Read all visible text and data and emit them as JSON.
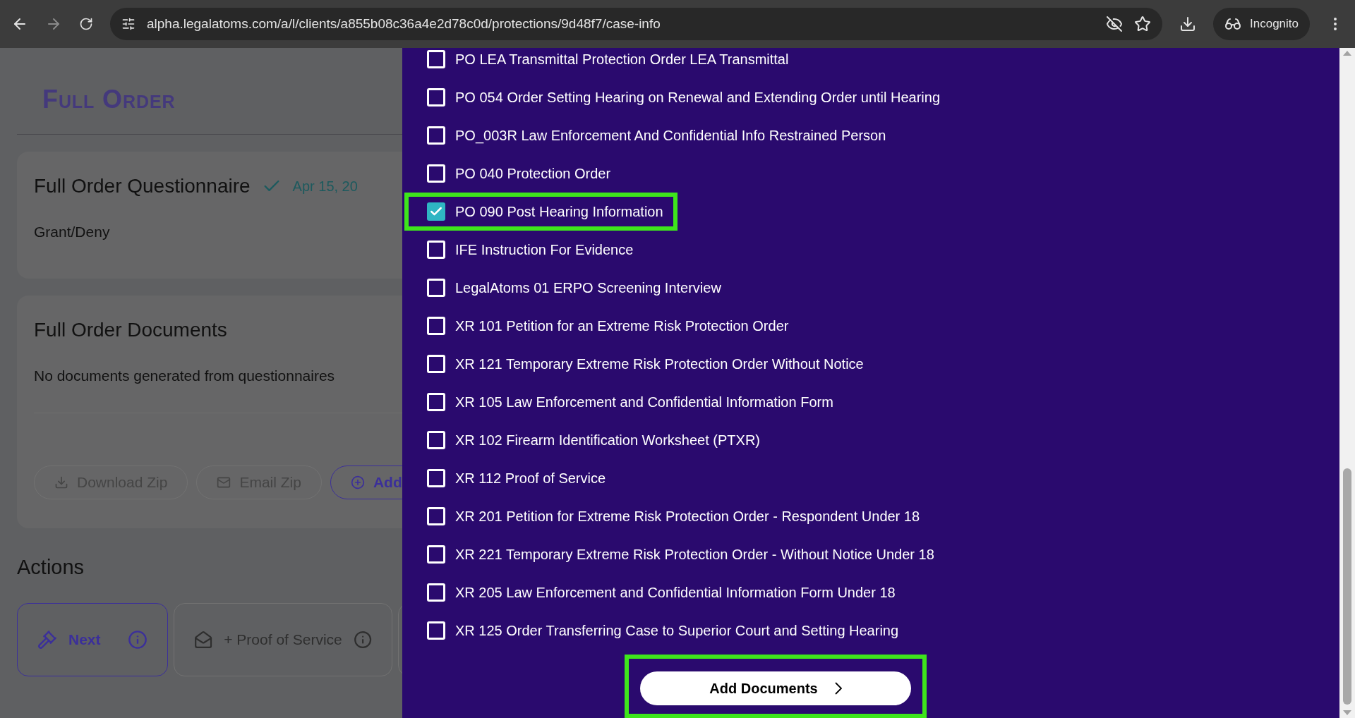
{
  "browser": {
    "url": "alpha.legalatoms.com/a/l/clients/a855b08c36a4e2d78c0d/protections/9d48f7/case-info",
    "profile": "Incognito"
  },
  "page": {
    "title": "Full Order",
    "questionnaire": {
      "title": "Full Order Questionnaire",
      "date": "Apr 15, 20",
      "answer": "Grant/Deny"
    },
    "documents": {
      "title": "Full Order Documents",
      "message": "No documents generated from questionnaires",
      "buttons": [
        {
          "kind": "download",
          "label": "Download Zip"
        },
        {
          "kind": "email",
          "label": "Email Zip"
        },
        {
          "kind": "add",
          "label": "Add"
        }
      ]
    },
    "actions": {
      "title": "Actions",
      "items": [
        {
          "kind": "gavel",
          "label": "Next",
          "selected": true
        },
        {
          "kind": "envelope",
          "label": "+ Proof of Service",
          "selected": false
        },
        {
          "kind": "blank",
          "selected": false
        }
      ]
    }
  },
  "drawer": {
    "documents": [
      {
        "label": "PO LEA Transmittal Protection Order LEA Transmittal",
        "checked": false,
        "highlighted": false
      },
      {
        "label": "PO 054 Order Setting Hearing on Renewal and Extending Order until Hearing",
        "checked": false,
        "highlighted": false
      },
      {
        "label": "PO_003R Law Enforcement And Confidential Info Restrained Person",
        "checked": false,
        "highlighted": false
      },
      {
        "label": "PO 040 Protection Order",
        "checked": false,
        "highlighted": false
      },
      {
        "label": "PO 090 Post Hearing Information",
        "checked": true,
        "highlighted": true
      },
      {
        "label": "IFE Instruction For Evidence",
        "checked": false,
        "highlighted": false
      },
      {
        "label": "LegalAtoms 01 ERPO Screening Interview",
        "checked": false,
        "highlighted": false
      },
      {
        "label": "XR 101 Petition for an Extreme Risk Protection Order",
        "checked": false,
        "highlighted": false
      },
      {
        "label": "XR 121 Temporary Extreme Risk Protection Order Without Notice",
        "checked": false,
        "highlighted": false
      },
      {
        "label": "XR 105 Law Enforcement and Confidential Information Form",
        "checked": false,
        "highlighted": false
      },
      {
        "label": "XR 102 Firearm Identification Worksheet (PTXR)",
        "checked": false,
        "highlighted": false
      },
      {
        "label": "XR 112 Proof of Service",
        "checked": false,
        "highlighted": false
      },
      {
        "label": "XR 201 Petition for Extreme Risk Protection Order - Respondent Under 18",
        "checked": false,
        "highlighted": false
      },
      {
        "label": "XR 221 Temporary Extreme Risk Protection Order - Without Notice Under 18",
        "checked": false,
        "highlighted": false
      },
      {
        "label": "XR 205 Law Enforcement and Confidential Information Form Under 18",
        "checked": false,
        "highlighted": false
      },
      {
        "label": "XR 125 Order Transferring Case to Superior Court and Setting Hearing",
        "checked": false,
        "highlighted": false
      }
    ],
    "submit": {
      "label": "Add Documents",
      "highlighted": true
    }
  }
}
